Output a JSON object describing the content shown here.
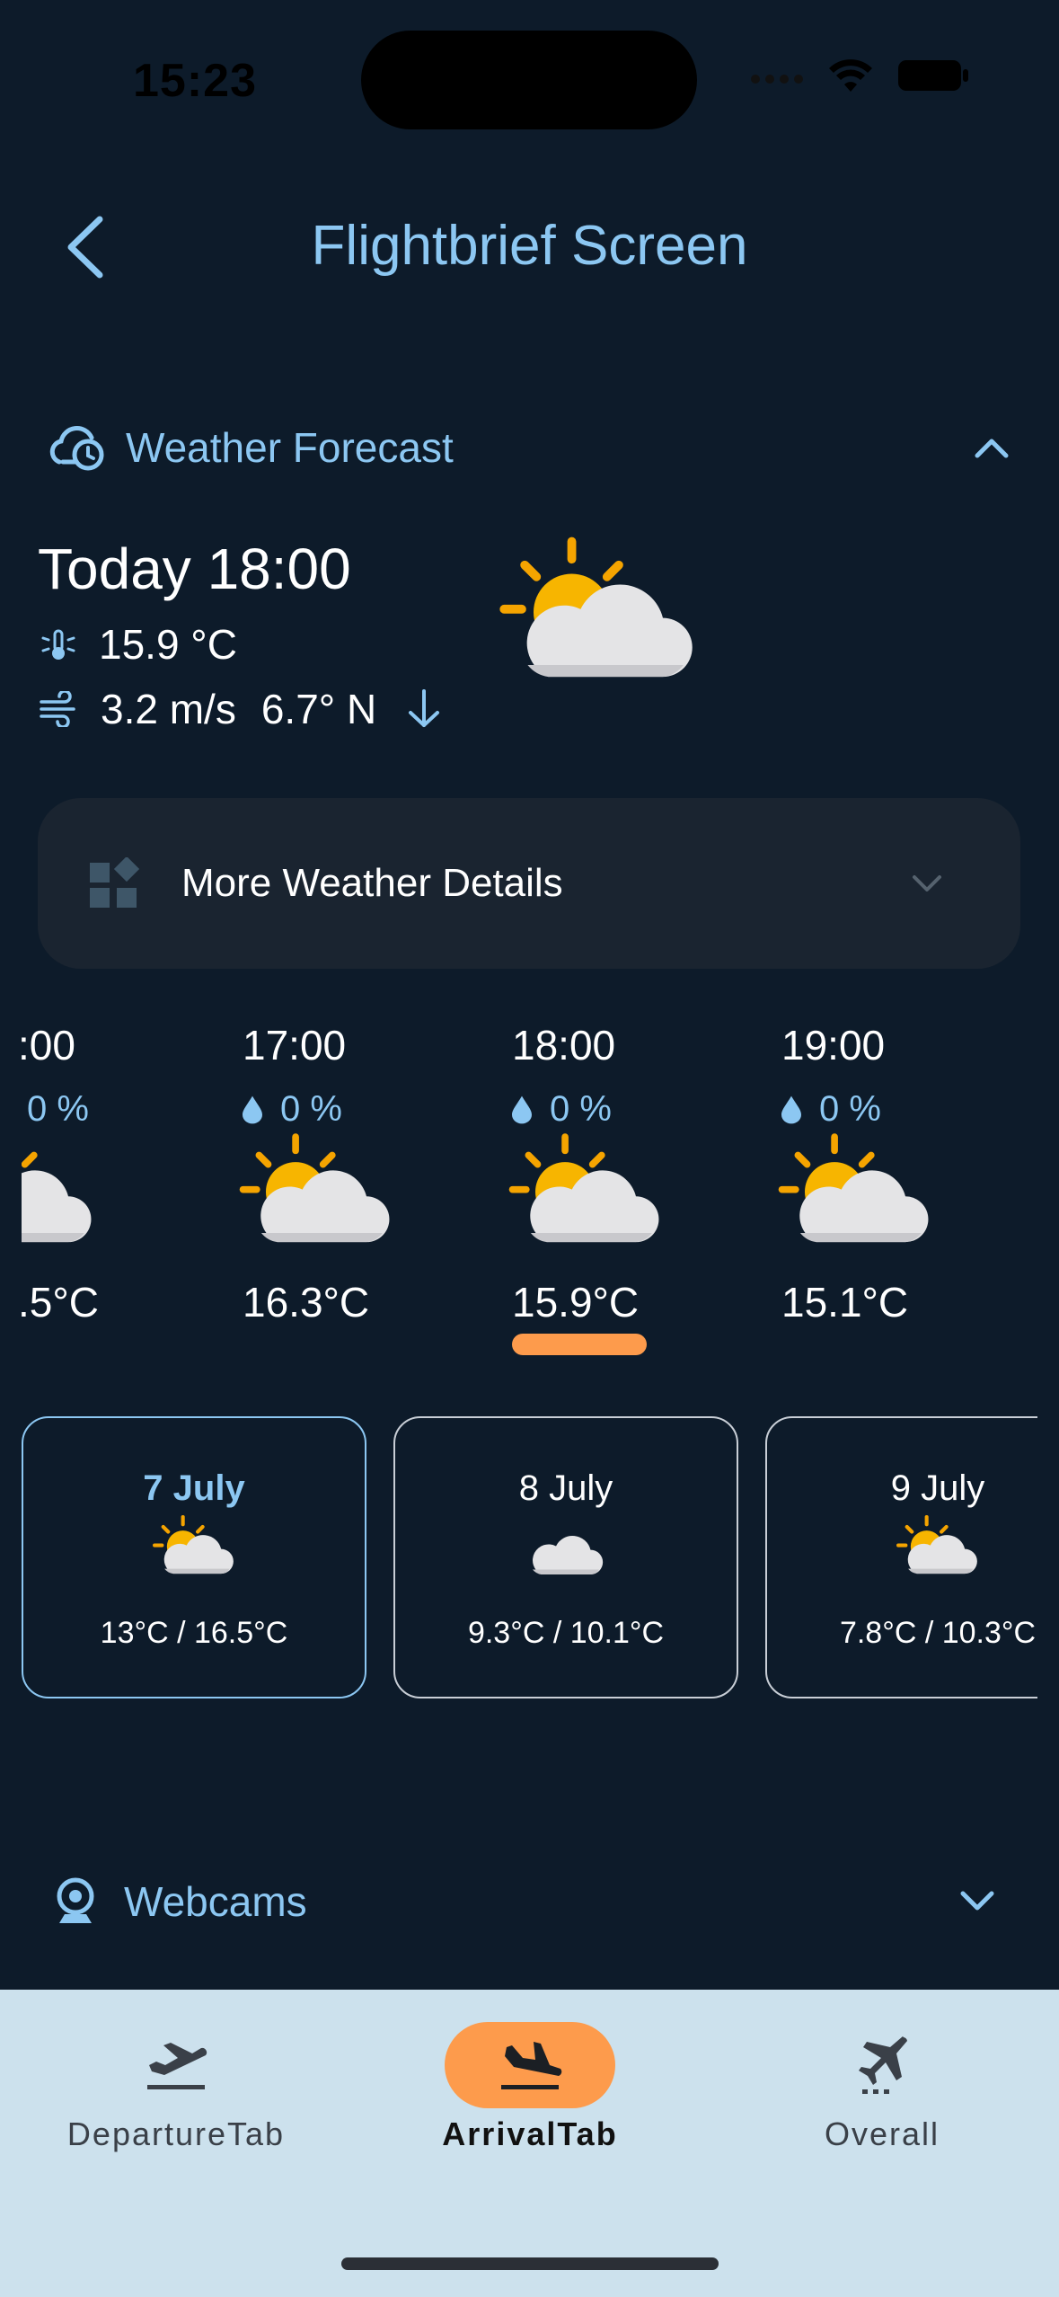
{
  "status": {
    "time": "15:23"
  },
  "header": {
    "title": "Flightbrief Screen"
  },
  "forecast": {
    "section_title": "Weather Forecast",
    "today_title": "Today 18:00",
    "temperature": "15.9 °C",
    "wind_speed": "3.2 m/s",
    "wind_direction": "6.7° N",
    "more_details_label": "More Weather Details"
  },
  "hourly": [
    {
      "time": ":00",
      "rain": "0 %",
      "temp": ".5°C"
    },
    {
      "time": "17:00",
      "rain": "0 %",
      "temp": "16.3°C"
    },
    {
      "time": "18:00",
      "rain": "0 %",
      "temp": "15.9°C"
    },
    {
      "time": "19:00",
      "rain": "0 %",
      "temp": "15.1°C"
    }
  ],
  "daily": [
    {
      "day": "7 July",
      "temps": "13°C / 16.5°C",
      "icon": "sun-behind-cloud-icon"
    },
    {
      "day": "8 July",
      "temps": "9.3°C / 10.1°C",
      "icon": "cloud-icon"
    },
    {
      "day": "9 July",
      "temps": "7.8°C / 10.3°C",
      "icon": "sun-behind-cloud-icon"
    }
  ],
  "webcams": {
    "section_title": "Webcams"
  },
  "tabs": [
    {
      "label": "DepartureTab",
      "icon": "plane-departure-icon"
    },
    {
      "label": "ArrivalTab",
      "icon": "plane-arrival-icon"
    },
    {
      "label": "Overall",
      "icon": "plane-icon"
    }
  ],
  "colors": {
    "accent": "#8cc7f2",
    "background": "#0d1b2a",
    "selection": "#fd9b4c",
    "tabbar": "#cce1ed"
  }
}
